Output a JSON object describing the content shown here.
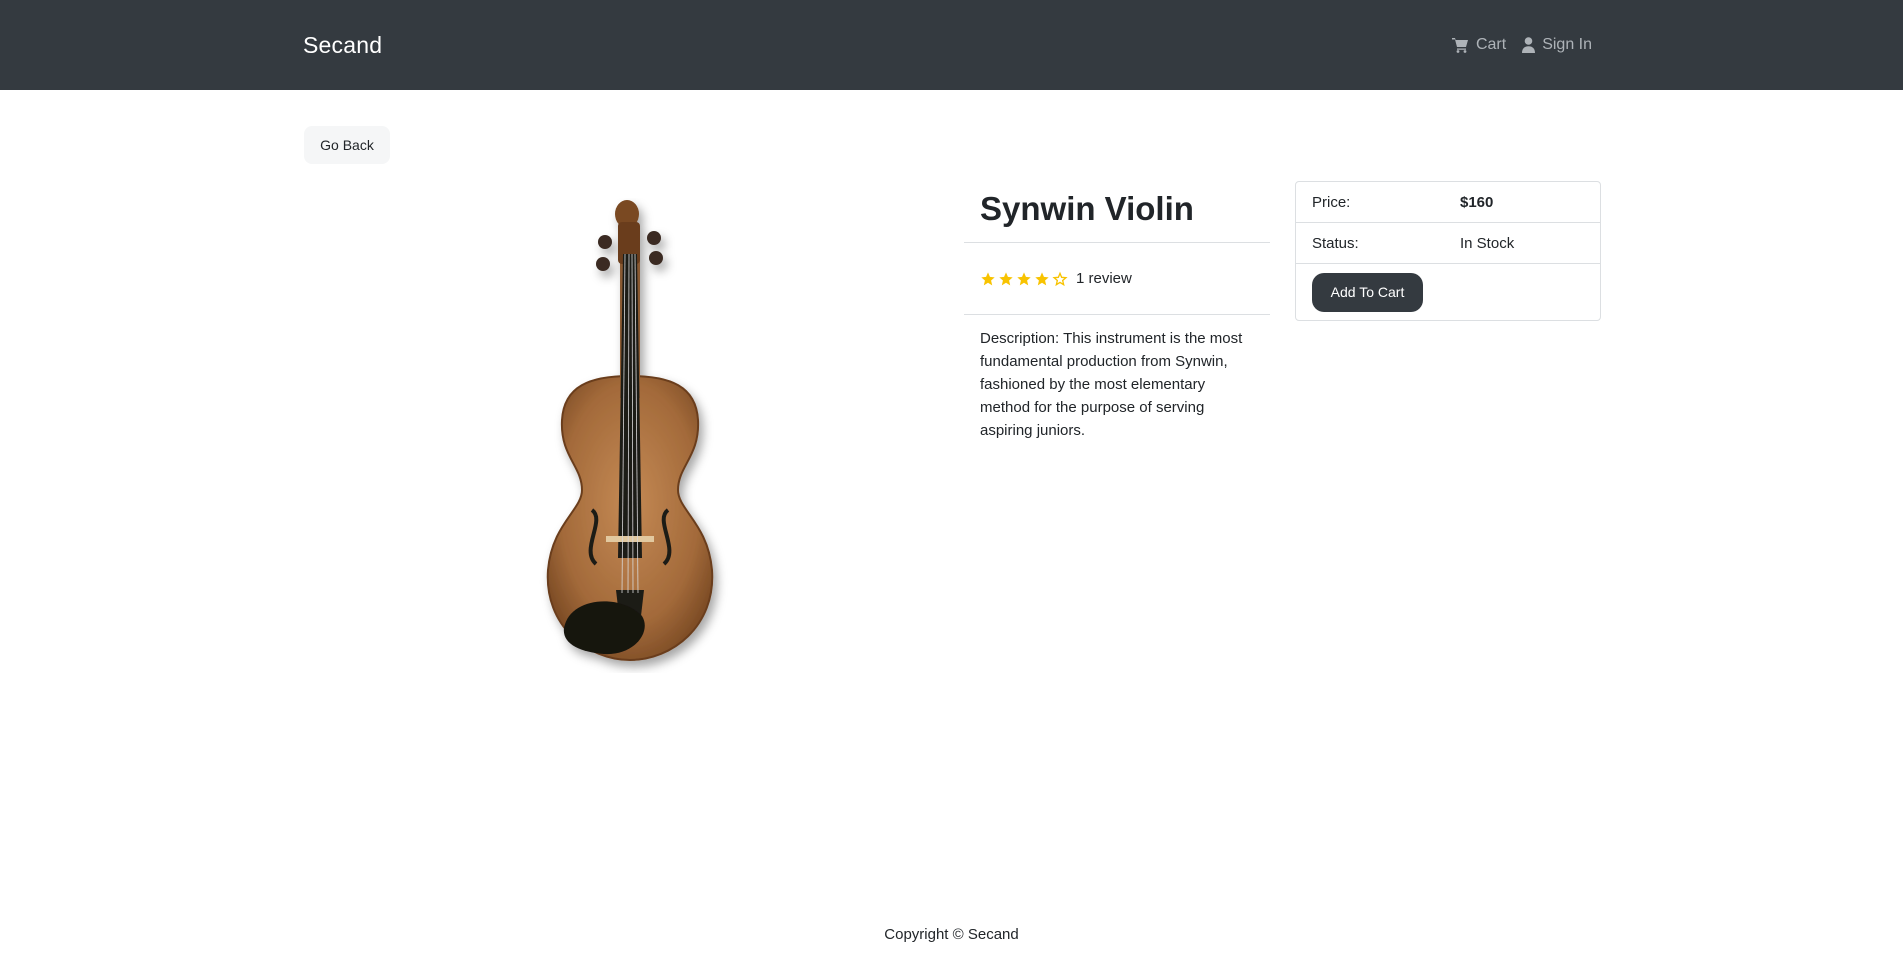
{
  "header": {
    "brand": "Secand",
    "cart_label": "Cart",
    "signin_label": "Sign In"
  },
  "go_back_label": "Go Back",
  "product": {
    "name": "Synwin Violin",
    "rating": 4,
    "rating_max": 5,
    "review_text": "1 review",
    "description": "Description: This instrument is the most fundamental production from Synwin, fashioned by the most elementary method for the purpose of serving aspiring juniors.",
    "image_icon": "violin-image"
  },
  "purchase": {
    "price_label": "Price:",
    "price_value": "$160",
    "status_label": "Status:",
    "status_value": "In Stock",
    "add_to_cart_label": "Add To Cart"
  },
  "footer": {
    "copyright": "Copyright © Secand"
  },
  "colors": {
    "navbar": "#343a40",
    "star": "#f8c300",
    "button": "#343a40"
  }
}
